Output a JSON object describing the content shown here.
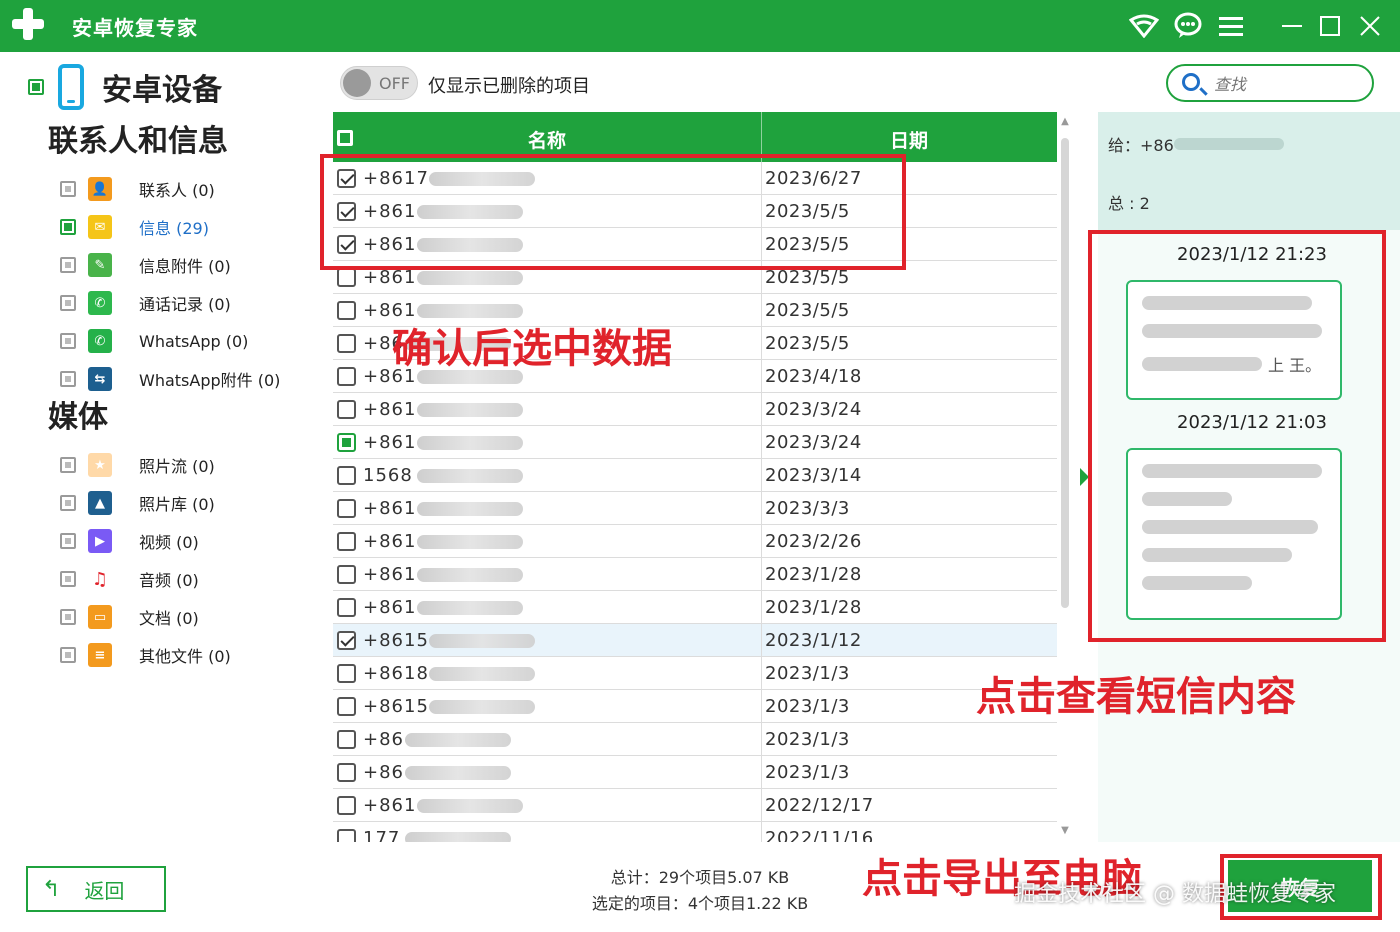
{
  "app": {
    "title": "安卓恢复专家",
    "accent": "#1fa23d",
    "annotation_color": "#e0232b"
  },
  "titlebar_icons": [
    "wifi-icon",
    "chat-icon",
    "menu-icon",
    "minimize-icon",
    "maximize-icon",
    "close-icon"
  ],
  "sidebar": {
    "device_label": "安卓设备",
    "sections": [
      {
        "title": "联系人和信息",
        "items": [
          {
            "label": "联系人 (0)",
            "icon": "contacts-icon",
            "color": "#f39a1e",
            "glyph": "👤",
            "state": "part"
          },
          {
            "label": "信息 (29)",
            "icon": "messages-icon",
            "color": "#f5c518",
            "glyph": "✉",
            "state": "green",
            "active": true
          },
          {
            "label": "信息附件 (0)",
            "icon": "attachment-icon",
            "color": "#49b34a",
            "glyph": "✎",
            "state": "part"
          },
          {
            "label": "通话记录 (0)",
            "icon": "phone-icon",
            "color": "#2db84d",
            "glyph": "✆",
            "state": "part"
          },
          {
            "label": "WhatsApp (0)",
            "icon": "whatsapp-icon",
            "color": "#25b14a",
            "glyph": "✆",
            "state": "part"
          },
          {
            "label": "WhatsApp附件 (0)",
            "icon": "whatsapp-attachment-icon",
            "color": "#1d5f8f",
            "glyph": "⇆",
            "state": "part"
          }
        ]
      },
      {
        "title": "媒体",
        "items": [
          {
            "label": "照片流 (0)",
            "icon": "photo-stream-icon",
            "color": "#ffd9a8",
            "glyph": "★",
            "state": "part"
          },
          {
            "label": "照片库 (0)",
            "icon": "photo-library-icon",
            "color": "#1f5f8f",
            "glyph": "▲",
            "state": "part"
          },
          {
            "label": "视频 (0)",
            "icon": "video-icon",
            "color": "#7a5af5",
            "glyph": "▶",
            "state": "part"
          },
          {
            "label": "音频 (0)",
            "icon": "audio-icon",
            "color": "#ffffff",
            "glyph": "♫",
            "state": "part"
          },
          {
            "label": "文档 (0)",
            "icon": "document-icon",
            "color": "#f39a1e",
            "glyph": "▭",
            "state": "part"
          },
          {
            "label": "其他文件 (0)",
            "icon": "other-files-icon",
            "color": "#f39a1e",
            "glyph": "≡",
            "state": "part"
          }
        ]
      }
    ],
    "back_label": "返回"
  },
  "toolbar": {
    "toggle_state": "OFF",
    "toggle_label": "仅显示已删除的项目",
    "search_placeholder": "查找"
  },
  "table": {
    "headers": {
      "name": "名称",
      "date": "日期"
    },
    "rows": [
      {
        "number": "+8617",
        "date": "2023/6/27",
        "check": "on"
      },
      {
        "number": "+861",
        "date": "2023/5/5",
        "check": "on"
      },
      {
        "number": "+861",
        "date": "2023/5/5",
        "check": "on"
      },
      {
        "number": "+861",
        "date": "2023/5/5",
        "check": "off"
      },
      {
        "number": "+861",
        "date": "2023/5/5",
        "check": "off"
      },
      {
        "number": "+86",
        "date": "2023/5/5",
        "check": "off"
      },
      {
        "number": "+861",
        "date": "2023/4/18",
        "check": "off"
      },
      {
        "number": "+861",
        "date": "2023/3/24",
        "check": "off"
      },
      {
        "number": "+861",
        "date": "2023/3/24",
        "check": "part"
      },
      {
        "number": "1568",
        "date": "2023/3/14",
        "check": "off"
      },
      {
        "number": "+861",
        "date": "2023/3/3",
        "check": "off"
      },
      {
        "number": "+861",
        "date": "2023/2/26",
        "check": "off"
      },
      {
        "number": "+861",
        "date": "2023/1/28",
        "check": "off"
      },
      {
        "number": "+861",
        "date": "2023/1/28",
        "check": "off"
      },
      {
        "number": "+8615",
        "date": "2023/1/12",
        "check": "on",
        "highlight": true
      },
      {
        "number": "+8618",
        "date": "2023/1/3",
        "check": "off"
      },
      {
        "number": "+8615",
        "date": "2023/1/3",
        "check": "off"
      },
      {
        "number": "+86",
        "date": "2023/1/3",
        "check": "off"
      },
      {
        "number": "+86",
        "date": "2023/1/3",
        "check": "off"
      },
      {
        "number": "+861",
        "date": "2022/12/17",
        "check": "off"
      },
      {
        "number": "177",
        "date": "2022/11/16",
        "check": "off"
      }
    ]
  },
  "preview": {
    "to_label": "给：+86",
    "total_label": "总 : 2",
    "messages": [
      {
        "time": "2023/1/12 21:23",
        "visible_text": "上 王。"
      },
      {
        "time": "2023/1/12 21:03",
        "visible_text": ""
      }
    ]
  },
  "annotations": {
    "select_data": "确认后选中数据",
    "view_sms": "点击查看短信内容",
    "export_pc": "点击导出至电脑"
  },
  "footer": {
    "total": "总计：29个项目5.07 KB",
    "selected": "选定的项目：4个项目1.22 KB",
    "export_label": "恢复"
  },
  "watermark": "掘金技术社区 @ 数据蛙恢复专家"
}
